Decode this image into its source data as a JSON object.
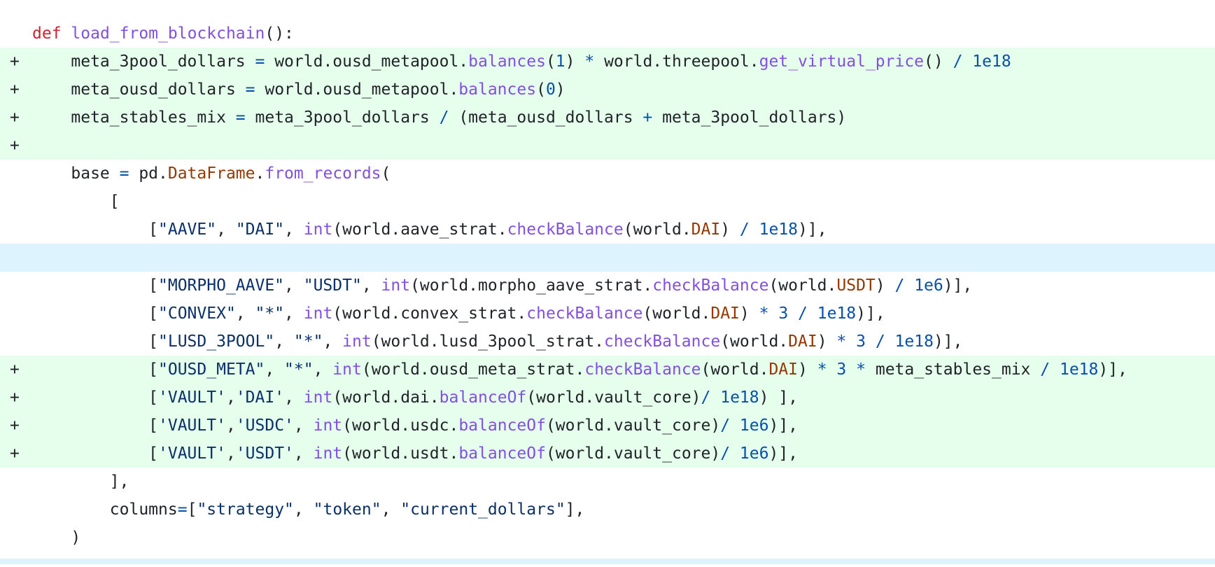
{
  "diff": {
    "lines": [
      {
        "type": "context",
        "marker": "",
        "tokens": [
          {
            "t": "def",
            "c": "kw"
          },
          {
            "t": " "
          },
          {
            "t": "load_from_blockchain",
            "c": "fn"
          },
          {
            "t": "():"
          }
        ]
      },
      {
        "type": "add",
        "marker": "+",
        "tokens": [
          {
            "t": "    meta_3pool_dollars "
          },
          {
            "t": "=",
            "c": "op"
          },
          {
            "t": " world.ousd_metapool."
          },
          {
            "t": "balances",
            "c": "fn"
          },
          {
            "t": "("
          },
          {
            "t": "1",
            "c": "num"
          },
          {
            "t": ") "
          },
          {
            "t": "*",
            "c": "op"
          },
          {
            "t": " world.threepool."
          },
          {
            "t": "get_virtual_price",
            "c": "fn"
          },
          {
            "t": "() "
          },
          {
            "t": "/",
            "c": "op"
          },
          {
            "t": " "
          },
          {
            "t": "1e18",
            "c": "num"
          }
        ]
      },
      {
        "type": "add",
        "marker": "+",
        "tokens": [
          {
            "t": "    meta_ousd_dollars "
          },
          {
            "t": "=",
            "c": "op"
          },
          {
            "t": " world.ousd_metapool."
          },
          {
            "t": "balances",
            "c": "fn"
          },
          {
            "t": "("
          },
          {
            "t": "0",
            "c": "num"
          },
          {
            "t": ")"
          }
        ]
      },
      {
        "type": "add",
        "marker": "+",
        "tokens": [
          {
            "t": "    meta_stables_mix "
          },
          {
            "t": "=",
            "c": "op"
          },
          {
            "t": " meta_3pool_dollars "
          },
          {
            "t": "/",
            "c": "op"
          },
          {
            "t": " (meta_ousd_dollars "
          },
          {
            "t": "+",
            "c": "op"
          },
          {
            "t": " meta_3pool_dollars)"
          }
        ]
      },
      {
        "type": "add",
        "marker": "+",
        "tokens": []
      },
      {
        "type": "context",
        "marker": "",
        "tokens": [
          {
            "t": "    base "
          },
          {
            "t": "=",
            "c": "op"
          },
          {
            "t": " pd."
          },
          {
            "t": "DataFrame",
            "c": "cls"
          },
          {
            "t": "."
          },
          {
            "t": "from_records",
            "c": "fn"
          },
          {
            "t": "("
          }
        ]
      },
      {
        "type": "context",
        "marker": "",
        "tokens": [
          {
            "t": "        ["
          }
        ]
      },
      {
        "type": "context",
        "marker": "",
        "tokens": [
          {
            "t": "            ["
          },
          {
            "t": "\"AAVE\"",
            "c": "str"
          },
          {
            "t": ", "
          },
          {
            "t": "\"DAI\"",
            "c": "str"
          },
          {
            "t": ", "
          },
          {
            "t": "int",
            "c": "fn"
          },
          {
            "t": "(world.aave_strat."
          },
          {
            "t": "checkBalance",
            "c": "fn"
          },
          {
            "t": "(world."
          },
          {
            "t": "DAI",
            "c": "cls"
          },
          {
            "t": ") "
          },
          {
            "t": "/",
            "c": "op"
          },
          {
            "t": " "
          },
          {
            "t": "1e18",
            "c": "num"
          },
          {
            "t": ")],"
          }
        ]
      },
      {
        "type": "hunk",
        "marker": "",
        "tokens": []
      },
      {
        "type": "context",
        "marker": "",
        "tokens": [
          {
            "t": "            ["
          },
          {
            "t": "\"MORPHO_AAVE\"",
            "c": "str"
          },
          {
            "t": ", "
          },
          {
            "t": "\"USDT\"",
            "c": "str"
          },
          {
            "t": ", "
          },
          {
            "t": "int",
            "c": "fn"
          },
          {
            "t": "(world.morpho_aave_strat."
          },
          {
            "t": "checkBalance",
            "c": "fn"
          },
          {
            "t": "(world."
          },
          {
            "t": "USDT",
            "c": "cls"
          },
          {
            "t": ") "
          },
          {
            "t": "/",
            "c": "op"
          },
          {
            "t": " "
          },
          {
            "t": "1e6",
            "c": "num"
          },
          {
            "t": ")],"
          }
        ]
      },
      {
        "type": "context",
        "marker": "",
        "tokens": [
          {
            "t": "            ["
          },
          {
            "t": "\"CONVEX\"",
            "c": "str"
          },
          {
            "t": ", "
          },
          {
            "t": "\"*\"",
            "c": "str"
          },
          {
            "t": ", "
          },
          {
            "t": "int",
            "c": "fn"
          },
          {
            "t": "(world.convex_strat."
          },
          {
            "t": "checkBalance",
            "c": "fn"
          },
          {
            "t": "(world."
          },
          {
            "t": "DAI",
            "c": "cls"
          },
          {
            "t": ") "
          },
          {
            "t": "*",
            "c": "op"
          },
          {
            "t": " "
          },
          {
            "t": "3",
            "c": "num"
          },
          {
            "t": " "
          },
          {
            "t": "/",
            "c": "op"
          },
          {
            "t": " "
          },
          {
            "t": "1e18",
            "c": "num"
          },
          {
            "t": ")],"
          }
        ]
      },
      {
        "type": "context",
        "marker": "",
        "tokens": [
          {
            "t": "            ["
          },
          {
            "t": "\"LUSD_3POOL\"",
            "c": "str"
          },
          {
            "t": ", "
          },
          {
            "t": "\"*\"",
            "c": "str"
          },
          {
            "t": ", "
          },
          {
            "t": "int",
            "c": "fn"
          },
          {
            "t": "(world.lusd_3pool_strat."
          },
          {
            "t": "checkBalance",
            "c": "fn"
          },
          {
            "t": "(world."
          },
          {
            "t": "DAI",
            "c": "cls"
          },
          {
            "t": ") "
          },
          {
            "t": "*",
            "c": "op"
          },
          {
            "t": " "
          },
          {
            "t": "3",
            "c": "num"
          },
          {
            "t": " "
          },
          {
            "t": "/",
            "c": "op"
          },
          {
            "t": " "
          },
          {
            "t": "1e18",
            "c": "num"
          },
          {
            "t": ")],"
          }
        ]
      },
      {
        "type": "add",
        "marker": "+",
        "tokens": [
          {
            "t": "            ["
          },
          {
            "t": "\"OUSD_META\"",
            "c": "str"
          },
          {
            "t": ", "
          },
          {
            "t": "\"*\"",
            "c": "str"
          },
          {
            "t": ", "
          },
          {
            "t": "int",
            "c": "fn"
          },
          {
            "t": "(world.ousd_meta_strat."
          },
          {
            "t": "checkBalance",
            "c": "fn"
          },
          {
            "t": "(world."
          },
          {
            "t": "DAI",
            "c": "cls"
          },
          {
            "t": ") "
          },
          {
            "t": "*",
            "c": "op"
          },
          {
            "t": " "
          },
          {
            "t": "3",
            "c": "num"
          },
          {
            "t": " "
          },
          {
            "t": "*",
            "c": "op"
          },
          {
            "t": " meta_stables_mix "
          },
          {
            "t": "/",
            "c": "op"
          },
          {
            "t": " "
          },
          {
            "t": "1e18",
            "c": "num"
          },
          {
            "t": ")],"
          }
        ]
      },
      {
        "type": "add",
        "marker": "+",
        "tokens": [
          {
            "t": "            ["
          },
          {
            "t": "'VAULT'",
            "c": "str"
          },
          {
            "t": ","
          },
          {
            "t": "'DAI'",
            "c": "str"
          },
          {
            "t": ", "
          },
          {
            "t": "int",
            "c": "fn"
          },
          {
            "t": "(world.dai."
          },
          {
            "t": "balanceOf",
            "c": "fn"
          },
          {
            "t": "(world.vault_core)"
          },
          {
            "t": "/",
            "c": "op"
          },
          {
            "t": " "
          },
          {
            "t": "1e18",
            "c": "num"
          },
          {
            "t": ") ],"
          }
        ]
      },
      {
        "type": "add",
        "marker": "+",
        "tokens": [
          {
            "t": "            ["
          },
          {
            "t": "'VAULT'",
            "c": "str"
          },
          {
            "t": ","
          },
          {
            "t": "'USDC'",
            "c": "str"
          },
          {
            "t": ", "
          },
          {
            "t": "int",
            "c": "fn"
          },
          {
            "t": "(world.usdc."
          },
          {
            "t": "balanceOf",
            "c": "fn"
          },
          {
            "t": "(world.vault_core)"
          },
          {
            "t": "/",
            "c": "op"
          },
          {
            "t": " "
          },
          {
            "t": "1e6",
            "c": "num"
          },
          {
            "t": ")],"
          }
        ]
      },
      {
        "type": "add",
        "marker": "+",
        "tokens": [
          {
            "t": "            ["
          },
          {
            "t": "'VAULT'",
            "c": "str"
          },
          {
            "t": ","
          },
          {
            "t": "'USDT'",
            "c": "str"
          },
          {
            "t": ", "
          },
          {
            "t": "int",
            "c": "fn"
          },
          {
            "t": "(world.usdt."
          },
          {
            "t": "balanceOf",
            "c": "fn"
          },
          {
            "t": "(world.vault_core)"
          },
          {
            "t": "/",
            "c": "op"
          },
          {
            "t": " "
          },
          {
            "t": "1e6",
            "c": "num"
          },
          {
            "t": ")],"
          }
        ]
      },
      {
        "type": "context",
        "marker": "",
        "tokens": [
          {
            "t": "        ],"
          }
        ]
      },
      {
        "type": "context",
        "marker": "",
        "tokens": [
          {
            "t": "        columns"
          },
          {
            "t": "=",
            "c": "op"
          },
          {
            "t": "["
          },
          {
            "t": "\"strategy\"",
            "c": "str"
          },
          {
            "t": ", "
          },
          {
            "t": "\"token\"",
            "c": "str"
          },
          {
            "t": ", "
          },
          {
            "t": "\"current_dollars\"",
            "c": "str"
          },
          {
            "t": "],"
          }
        ]
      },
      {
        "type": "context",
        "marker": "",
        "tokens": [
          {
            "t": "    )"
          }
        ]
      },
      {
        "type": "hunk-small",
        "marker": "",
        "tokens": []
      }
    ]
  },
  "colors": {
    "added_background": "#e6ffec",
    "hunk_background": "#ddf4ff",
    "keyword": "#cf222e",
    "function": "#8250df",
    "class_constant": "#953800",
    "number_operator": "#0550ae",
    "string": "#0a3069"
  }
}
